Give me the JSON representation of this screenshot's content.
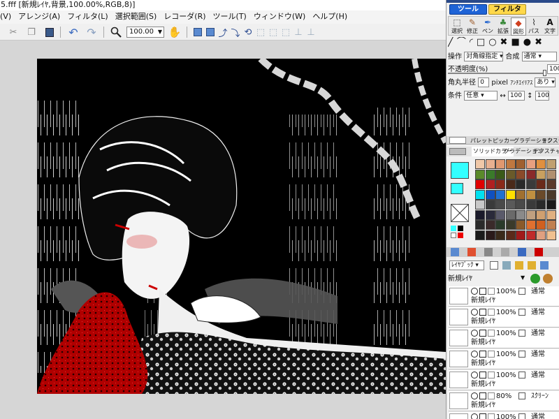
{
  "window": {
    "title": "5.fff [新規ﾚｲﾔ,背景,100.00%,RGB,8)]"
  },
  "menu": [
    "(V)",
    "アレンジ(A)",
    "フィルタ(L)",
    "選択範囲(S)",
    "レコーダ(R)",
    "ツール(T)",
    "ウィンドウ(W)",
    "ヘルプ(H)"
  ],
  "toolbar": {
    "zoom": "100.00"
  },
  "panel": {
    "top_tabs": [
      "ツール",
      "フィルタ"
    ],
    "tools": [
      "選択",
      "修正",
      "ペン",
      "拡張",
      "図形",
      "パス",
      "文字"
    ],
    "op_label": "操作",
    "op_value": "対角線指定",
    "blend_label": "合成",
    "blend_value": "通常",
    "opacity_label": "不透明度(%)",
    "opacity_value": "100",
    "radius_label": "角丸半径",
    "radius_value": "0",
    "radius_unit": "pixel",
    "aa_label": "ｱﾝﾁｴｲﾘｱｽ",
    "aa_value": "あり",
    "cond_label": "条件",
    "cond_value": "任意",
    "w_value": "100",
    "h_value": "100",
    "color_tabs": [
      "パレット",
      "ピッカー",
      "グラデーション",
      "テクスチャ"
    ],
    "color_subtabs": [
      "ソリッドカラー",
      "グラデーション",
      "テクスチャ"
    ],
    "layerbook_label": "ﾚｲﾔﾌﾞｯｸ",
    "new_layer_label": "新規ﾚｲﾔ"
  },
  "colors": {
    "fg": "#33ffff",
    "bg": "#33ffff"
  },
  "palette": [
    "#f0c8a8",
    "#e8b090",
    "#e09870",
    "#c07840",
    "#a06030",
    "#e8a080",
    "#e09040",
    "#c0a070",
    "#5a8a2a",
    "#3a7a2a",
    "#3a5a1a",
    "#6a5a2a",
    "#8a4a2a",
    "#8a2a2a",
    "#c8a060",
    "#b09070",
    "#e00000",
    "#b02020",
    "#8a2a1a",
    "#4a2a1a",
    "#2a2a2a",
    "#3a3a3a",
    "#6a2a1a",
    "#5a3a2a",
    "#00e0f0",
    "#1050c0",
    "#2070d0",
    "#ffe000",
    "#a07030",
    "#c09040",
    "#6a4a2a",
    "#4a3a2a",
    "#c8c8c8",
    "#3a3a3a",
    "#4a4a4a",
    "#5a5a5a",
    "#4a4a4a",
    "#3a3a3a",
    "#2a2a2a",
    "#1a1a1a",
    "#1a1a2a",
    "#2a2a3a",
    "#5a5a6a",
    "#6a6a6a",
    "#8a8a8a",
    "#c0a080",
    "#d0a070",
    "#e0b080",
    "#2a2a2a",
    "#3a2a2a",
    "#2a3a2a",
    "#3a3a2a",
    "#8a5a2a",
    "#e07030",
    "#d06020",
    "#c08050",
    "#1a1a1a",
    "#2a1a1a",
    "#3a2a1a",
    "#5a2a1a",
    "#a01a1a",
    "#c02a2a",
    "#e0a080",
    "#f0c090"
  ],
  "layers": [
    {
      "name": "新規ﾚｲﾔ",
      "opacity": "100%",
      "mode": "通常"
    },
    {
      "name": "新規ﾚｲﾔ",
      "opacity": "100%",
      "mode": "通常"
    },
    {
      "name": "新規ﾚｲﾔ",
      "opacity": "100%",
      "mode": "通常"
    },
    {
      "name": "新規ﾚｲﾔ",
      "opacity": "100%",
      "mode": "通常"
    },
    {
      "name": "新規ﾚｲﾔ",
      "opacity": "100%",
      "mode": "通常"
    },
    {
      "name": "新規ﾚｲﾔ",
      "opacity": "80%",
      "mode": "ｽｸﾘｰﾝ"
    },
    {
      "name": "",
      "opacity": "100%",
      "mode": "通常"
    }
  ]
}
